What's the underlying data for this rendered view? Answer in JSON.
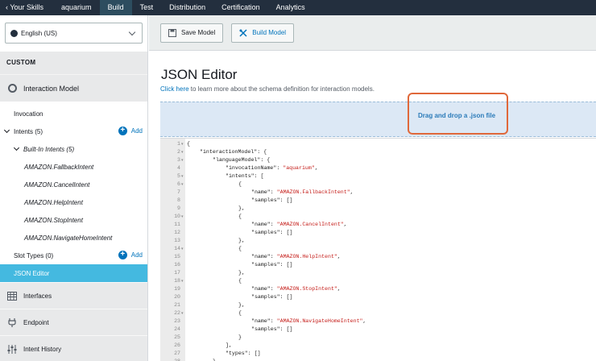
{
  "topnav": {
    "back_label": "‹ Your Skills",
    "skill_name": "aquarium",
    "tabs": [
      {
        "label": "Build",
        "active": true
      },
      {
        "label": "Test",
        "active": false
      },
      {
        "label": "Distribution",
        "active": false
      },
      {
        "label": "Certification",
        "active": false
      },
      {
        "label": "Analytics",
        "active": false
      }
    ]
  },
  "sidebar": {
    "language": "English (US)",
    "section_label": "CUSTOM",
    "interaction_model_label": "Interaction Model",
    "invocation_label": "Invocation",
    "intents_label": "Intents (5)",
    "add_label": "Add",
    "builtin_label": "Built-In Intents (5)",
    "intents": [
      "AMAZON.FallbackIntent",
      "AMAZON.CancelIntent",
      "AMAZON.HelpIntent",
      "AMAZON.StopIntent",
      "AMAZON.NavigateHomeIntent"
    ],
    "slot_types_label": "Slot Types (0)",
    "json_editor_label": "JSON Editor",
    "interfaces_label": "Interfaces",
    "endpoint_label": "Endpoint",
    "intent_history_label": "Intent History"
  },
  "toolbar": {
    "save_label": "Save Model",
    "build_label": "Build Model"
  },
  "main": {
    "title": "JSON Editor",
    "info_link": "Click here",
    "info_text": " to learn more about the schema definition for interaction models.",
    "drop_text": "Drag and drop a .json file"
  },
  "editor": {
    "lines": [
      {
        "n": "1",
        "fold": true,
        "indent": 0,
        "tokens": [
          [
            "pun",
            "{"
          ]
        ]
      },
      {
        "n": "2",
        "fold": true,
        "indent": 1,
        "tokens": [
          [
            "key",
            "\"interactionModel\""
          ],
          [
            "pun",
            ": {"
          ]
        ]
      },
      {
        "n": "3",
        "fold": true,
        "indent": 2,
        "tokens": [
          [
            "key",
            "\"languageModel\""
          ],
          [
            "pun",
            ": {"
          ]
        ]
      },
      {
        "n": "4",
        "fold": false,
        "indent": 3,
        "tokens": [
          [
            "key",
            "\"invocationName\""
          ],
          [
            "pun",
            ": "
          ],
          [
            "str",
            "\"aquarium\""
          ],
          [
            "pun",
            ","
          ]
        ]
      },
      {
        "n": "5",
        "fold": true,
        "indent": 3,
        "tokens": [
          [
            "key",
            "\"intents\""
          ],
          [
            "pun",
            ": ["
          ]
        ]
      },
      {
        "n": "6",
        "fold": true,
        "indent": 4,
        "tokens": [
          [
            "pun",
            "{"
          ]
        ]
      },
      {
        "n": "7",
        "fold": false,
        "indent": 5,
        "tokens": [
          [
            "key",
            "\"name\""
          ],
          [
            "pun",
            ": "
          ],
          [
            "str",
            "\"AMAZON.FallbackIntent\""
          ],
          [
            "pun",
            ","
          ]
        ]
      },
      {
        "n": "8",
        "fold": false,
        "indent": 5,
        "tokens": [
          [
            "key",
            "\"samples\""
          ],
          [
            "pun",
            ": []"
          ]
        ]
      },
      {
        "n": "9",
        "fold": false,
        "indent": 4,
        "tokens": [
          [
            "pun",
            "},"
          ]
        ]
      },
      {
        "n": "10",
        "fold": true,
        "indent": 4,
        "tokens": [
          [
            "pun",
            "{"
          ]
        ]
      },
      {
        "n": "11",
        "fold": false,
        "indent": 5,
        "tokens": [
          [
            "key",
            "\"name\""
          ],
          [
            "pun",
            ": "
          ],
          [
            "str",
            "\"AMAZON.CancelIntent\""
          ],
          [
            "pun",
            ","
          ]
        ]
      },
      {
        "n": "12",
        "fold": false,
        "indent": 5,
        "tokens": [
          [
            "key",
            "\"samples\""
          ],
          [
            "pun",
            ": []"
          ]
        ]
      },
      {
        "n": "13",
        "fold": false,
        "indent": 4,
        "tokens": [
          [
            "pun",
            "},"
          ]
        ]
      },
      {
        "n": "14",
        "fold": true,
        "indent": 4,
        "tokens": [
          [
            "pun",
            "{"
          ]
        ]
      },
      {
        "n": "15",
        "fold": false,
        "indent": 5,
        "tokens": [
          [
            "key",
            "\"name\""
          ],
          [
            "pun",
            ": "
          ],
          [
            "str",
            "\"AMAZON.HelpIntent\""
          ],
          [
            "pun",
            ","
          ]
        ]
      },
      {
        "n": "16",
        "fold": false,
        "indent": 5,
        "tokens": [
          [
            "key",
            "\"samples\""
          ],
          [
            "pun",
            ": []"
          ]
        ]
      },
      {
        "n": "17",
        "fold": false,
        "indent": 4,
        "tokens": [
          [
            "pun",
            "},"
          ]
        ]
      },
      {
        "n": "18",
        "fold": true,
        "indent": 4,
        "tokens": [
          [
            "pun",
            "{"
          ]
        ]
      },
      {
        "n": "19",
        "fold": false,
        "indent": 5,
        "tokens": [
          [
            "key",
            "\"name\""
          ],
          [
            "pun",
            ": "
          ],
          [
            "str",
            "\"AMAZON.StopIntent\""
          ],
          [
            "pun",
            ","
          ]
        ]
      },
      {
        "n": "20",
        "fold": false,
        "indent": 5,
        "tokens": [
          [
            "key",
            "\"samples\""
          ],
          [
            "pun",
            ": []"
          ]
        ]
      },
      {
        "n": "21",
        "fold": false,
        "indent": 4,
        "tokens": [
          [
            "pun",
            "},"
          ]
        ]
      },
      {
        "n": "22",
        "fold": true,
        "indent": 4,
        "tokens": [
          [
            "pun",
            "{"
          ]
        ]
      },
      {
        "n": "23",
        "fold": false,
        "indent": 5,
        "tokens": [
          [
            "key",
            "\"name\""
          ],
          [
            "pun",
            ": "
          ],
          [
            "str",
            "\"AMAZON.NavigateHomeIntent\""
          ],
          [
            "pun",
            ","
          ]
        ]
      },
      {
        "n": "24",
        "fold": false,
        "indent": 5,
        "tokens": [
          [
            "key",
            "\"samples\""
          ],
          [
            "pun",
            ": []"
          ]
        ]
      },
      {
        "n": "25",
        "fold": false,
        "indent": 4,
        "tokens": [
          [
            "pun",
            "}"
          ]
        ]
      },
      {
        "n": "26",
        "fold": false,
        "indent": 3,
        "tokens": [
          [
            "pun",
            "],"
          ]
        ]
      },
      {
        "n": "27",
        "fold": false,
        "indent": 3,
        "tokens": [
          [
            "key",
            "\"types\""
          ],
          [
            "pun",
            ": []"
          ]
        ]
      },
      {
        "n": "28",
        "fold": false,
        "indent": 2,
        "tokens": [
          [
            "pun",
            "}"
          ]
        ]
      }
    ]
  }
}
